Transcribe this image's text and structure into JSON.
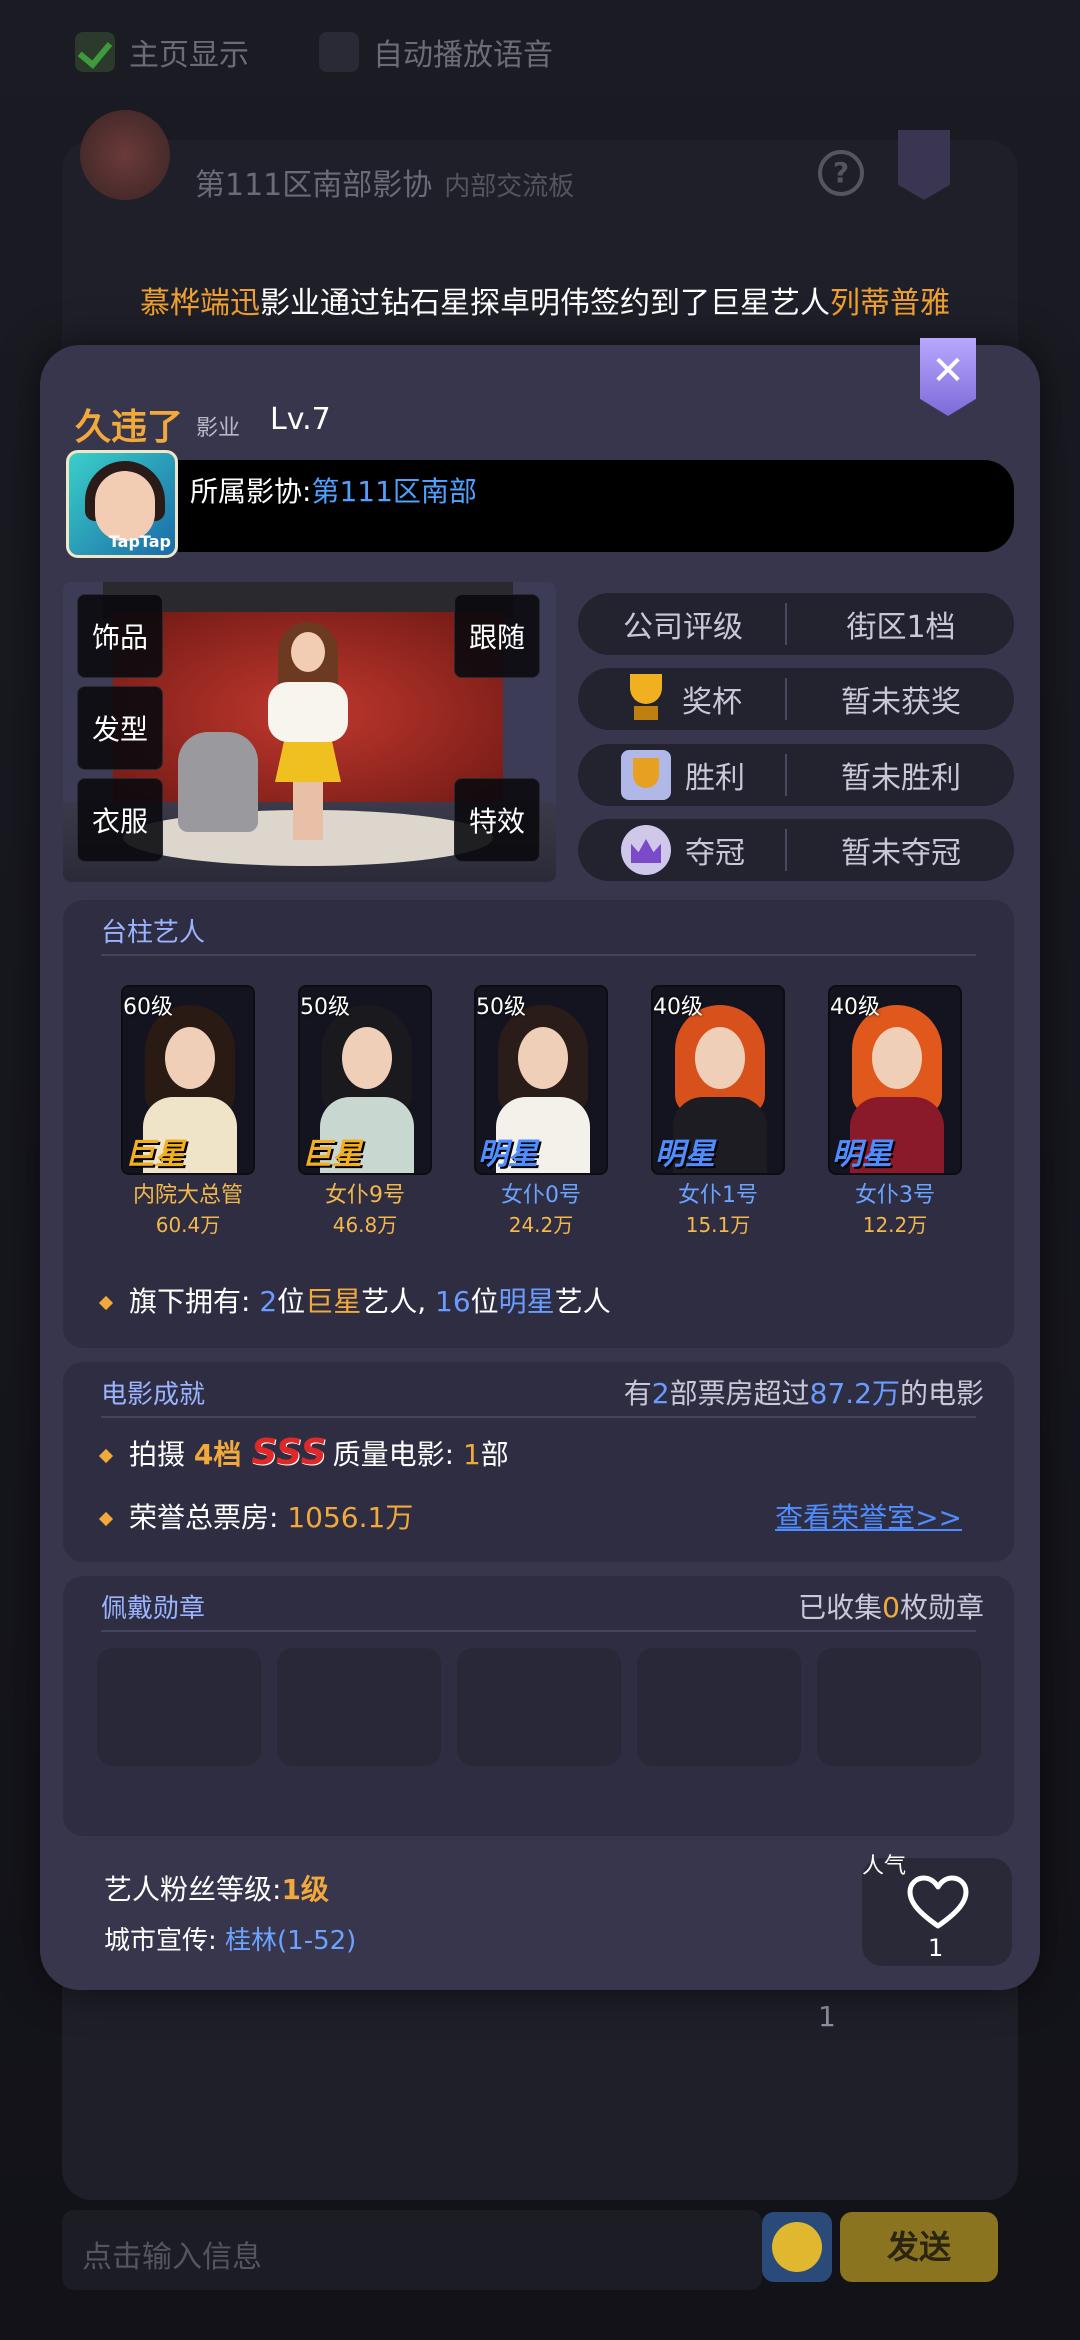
{
  "background": {
    "checkbox_home_label": "主页显示",
    "checkbox_voice_label": "自动播放语音",
    "panel_title": "第111区南部影协",
    "panel_subtitle": "内部交流板",
    "marquee_name1": "慕桦端迅",
    "marquee_middle": "影业通过钻石星探卓明伟签约到了巨星艺人",
    "marquee_name2": "列蒂普雅",
    "chat_placeholder": "点击输入信息",
    "send_label": "发送",
    "under_num": "1"
  },
  "profile": {
    "name": "久违了",
    "type": "影业",
    "level": "Lv.7",
    "avatar_badge": "TapTap",
    "association_label": "所属影协:",
    "association_value": "第111区南部"
  },
  "room_buttons": {
    "accessories": "饰品",
    "hairstyle": "发型",
    "clothing": "衣服",
    "follow": "跟随",
    "effects": "特效"
  },
  "stats": [
    {
      "key": "公司评级",
      "value": "街区1档",
      "icon": ""
    },
    {
      "key": "奖杯",
      "value": "暂未获奖",
      "icon": "trophy-icon"
    },
    {
      "key": "胜利",
      "value": "暂未胜利",
      "icon": "victory-icon"
    },
    {
      "key": "夺冠",
      "value": "暂未夺冠",
      "icon": "crown-icon"
    }
  ],
  "artists_section": {
    "title": "台柱艺人",
    "artists": [
      {
        "level": "60级",
        "rank": "巨星",
        "name": "内院大总管",
        "value": "60.4万",
        "hair": "#2a1a14",
        "body": "#f0e4c8"
      },
      {
        "level": "50级",
        "rank": "巨星",
        "name": "女仆9号",
        "value": "46.8万",
        "hair": "#1a1a1e",
        "body": "#c8d8d0"
      },
      {
        "level": "50级",
        "rank": "明星",
        "name": "女仆0号",
        "value": "24.2万",
        "hair": "#2a1c18",
        "body": "#f4f0ea"
      },
      {
        "level": "40级",
        "rank": "明星",
        "name": "女仆1号",
        "value": "15.1万",
        "hair": "#d8501c",
        "body": "#1c1c22"
      },
      {
        "level": "40级",
        "rank": "明星",
        "name": "女仆3号",
        "value": "12.2万",
        "hair": "#e0581c",
        "body": "#8a1a2a"
      }
    ],
    "summary_prefix": "旗下拥有: ",
    "superstar_count": "2",
    "summary_mid1": "位",
    "superstar_word": "巨星",
    "summary_mid2": "艺人, ",
    "star_count": "16",
    "summary_mid3": "位",
    "star_word": "明星",
    "summary_suffix": "艺人"
  },
  "movie_section": {
    "title": "电影成就",
    "right_prefix": "有",
    "right_count": "2",
    "right_mid": "部票房超过",
    "right_amount": "87.2万",
    "right_suffix": "的电影",
    "shoot_label": "拍摄 ",
    "grade": "4档",
    "quality": "SSS",
    "quality_suffix": "质量电影: ",
    "quality_count": "1",
    "quality_unit": "部",
    "box_label": "荣誉总票房: ",
    "box_value": "1056.1万",
    "honor_link": "查看荣誉室>>"
  },
  "medal_section": {
    "title": "佩戴勋章",
    "right_prefix": "已收集",
    "right_count": "0",
    "right_suffix": "枚勋章"
  },
  "footer": {
    "fan_label": "艺人粉丝等级:",
    "fan_value": "1级",
    "city_label": "城市宣传: ",
    "city_value": "桂林(1-52)",
    "popularity_label": "人气",
    "popularity_count": "1"
  }
}
